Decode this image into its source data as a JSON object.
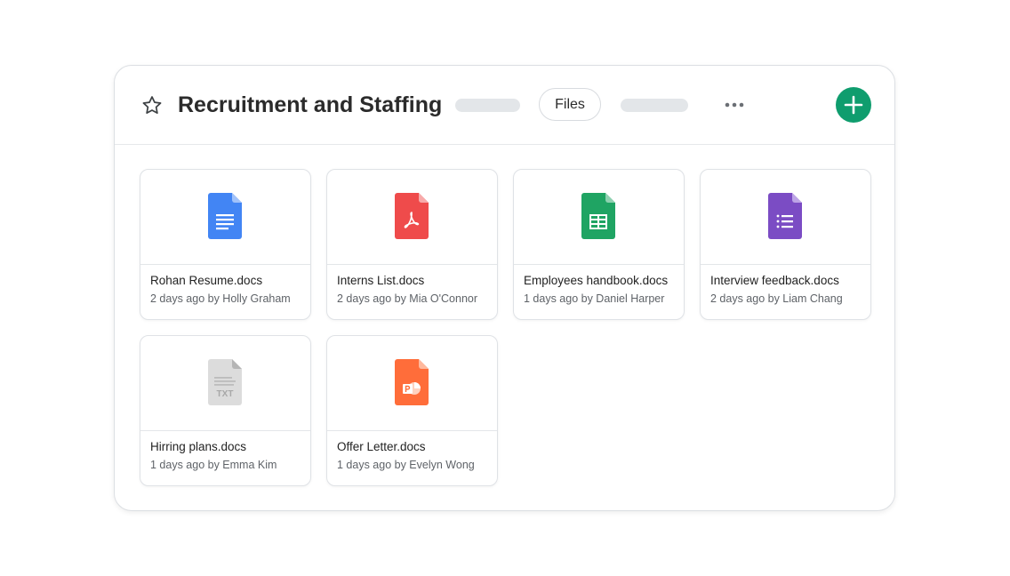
{
  "header": {
    "title": "Recruitment and Staffing",
    "files_label": "Files"
  },
  "colors": {
    "accent": "#0f9d6e",
    "docs": "#4285f4",
    "pdf": "#ef4b4b",
    "sheets": "#1fa463",
    "forms": "#7b4cc4",
    "txt": "#d9d9d9",
    "slides": "#ff6d3a"
  },
  "files": [
    {
      "name": "Rohan Resume.docs",
      "meta": "2 days ago by Holly Graham",
      "icon": "google-docs-icon"
    },
    {
      "name": "Interns List.docs",
      "meta": "2 days ago by Mia O'Connor",
      "icon": "pdf-icon"
    },
    {
      "name": "Employees handbook.docs",
      "meta": "1 days ago by Daniel Harper",
      "icon": "google-sheets-icon"
    },
    {
      "name": "Interview feedback.docs",
      "meta": "2 days ago by Liam Chang",
      "icon": "google-forms-icon"
    },
    {
      "name": "Hirring plans.docs",
      "meta": "1 days ago by Emma Kim",
      "icon": "txt-file-icon"
    },
    {
      "name": "Offer Letter.docs",
      "meta": "1 days ago by Evelyn Wong",
      "icon": "powerpoint-icon"
    }
  ],
  "icon_labels": {
    "txt": "TXT"
  }
}
